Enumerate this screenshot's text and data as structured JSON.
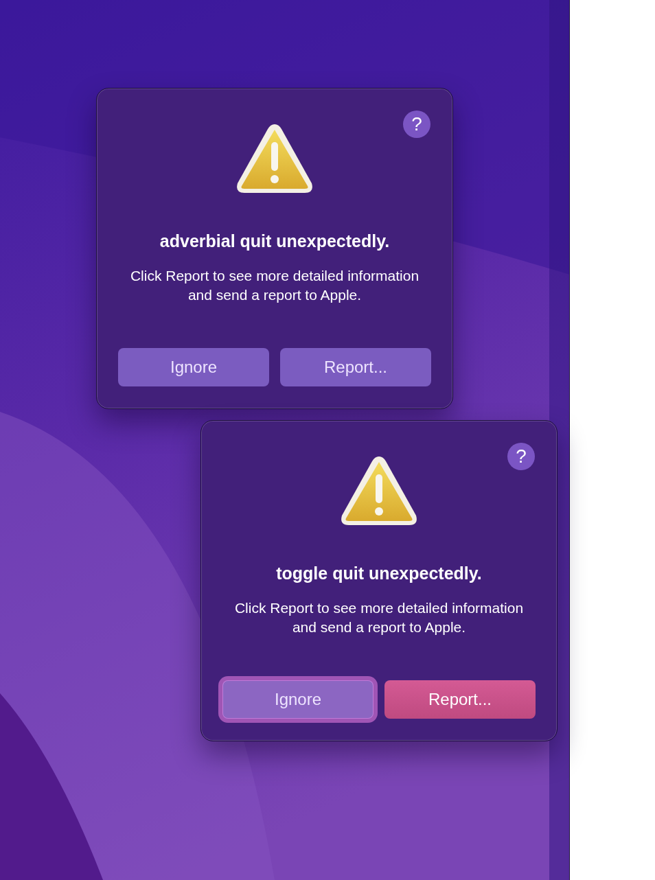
{
  "dialogs": [
    {
      "title": "adverbial quit unexpectedly.",
      "message": "Click Report to see more detailed information and send a report to Apple.",
      "help": "?",
      "buttons": [
        {
          "label": "Ignore",
          "kind": "plain",
          "focused": false
        },
        {
          "label": "Report...",
          "kind": "plain",
          "focused": false
        }
      ]
    },
    {
      "title": "toggle quit unexpectedly.",
      "message": "Click Report to see more detailed information and send a report to Apple.",
      "help": "?",
      "buttons": [
        {
          "label": "Ignore",
          "kind": "plain",
          "focused": true
        },
        {
          "label": "Report...",
          "kind": "accent",
          "focused": false
        }
      ]
    }
  ]
}
